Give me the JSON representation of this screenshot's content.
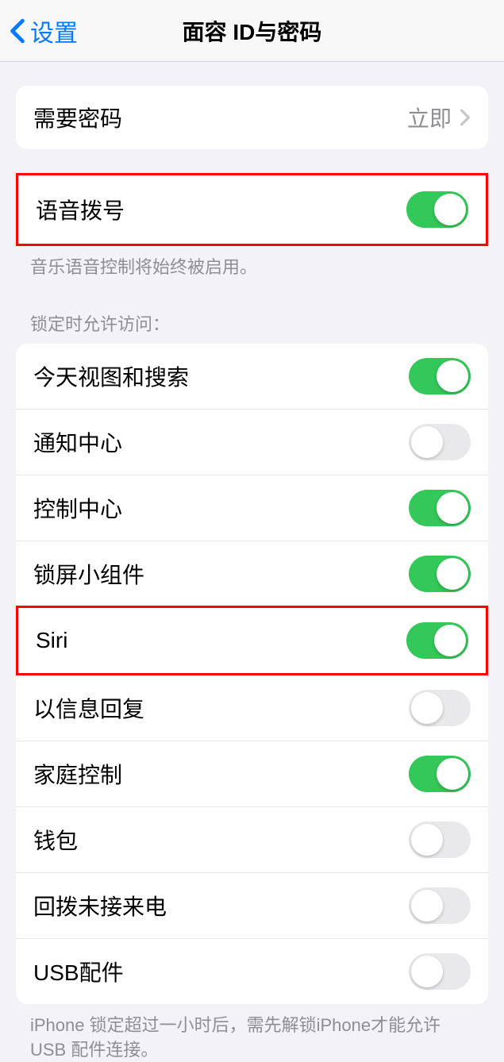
{
  "header": {
    "back_label": "设置",
    "title": "面容 ID与密码"
  },
  "passcode_group": {
    "require_passcode": {
      "label": "需要密码",
      "value": "立即"
    }
  },
  "voice_dial": {
    "label": "语音拨号",
    "enabled": true,
    "footer": "音乐语音控制将始终被启用。"
  },
  "lock_access": {
    "header": "锁定时允许访问：",
    "items": [
      {
        "label": "今天视图和搜索",
        "enabled": true
      },
      {
        "label": "通知中心",
        "enabled": false
      },
      {
        "label": "控制中心",
        "enabled": true
      },
      {
        "label": "锁屏小组件",
        "enabled": true
      },
      {
        "label": "Siri",
        "enabled": true
      },
      {
        "label": "以信息回复",
        "enabled": false
      },
      {
        "label": "家庭控制",
        "enabled": true
      },
      {
        "label": "钱包",
        "enabled": false
      },
      {
        "label": "回拨未接来电",
        "enabled": false
      },
      {
        "label": "USB配件",
        "enabled": false
      }
    ],
    "footer": "iPhone 锁定超过一小时后，需先解锁iPhone才能允许USB 配件连接。"
  }
}
